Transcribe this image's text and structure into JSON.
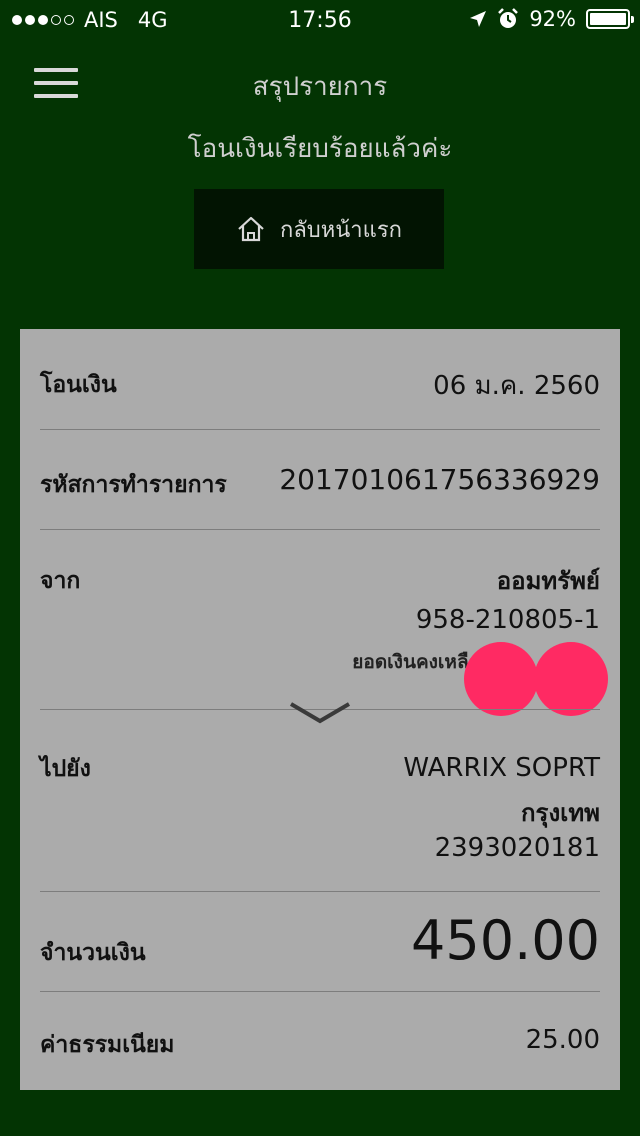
{
  "status_bar": {
    "carrier": "AIS",
    "network": "4G",
    "time": "17:56",
    "battery": "92%",
    "battery_level": 0.92,
    "signal_bars_filled": 3,
    "signal_bars_total": 5
  },
  "header": {
    "title": "สรุปรายการ",
    "subtitle": "โอนเงินเรียบร้อยแล้วค่ะ",
    "home_button_label": "กลับหน้าแรก"
  },
  "summary": {
    "transfer_label": "โอนเงิน",
    "transfer_date": "06 ม.ค. 2560",
    "ref_label": "รหัสการทำรายการ",
    "ref_value": "20170106175633692​9",
    "from_label": "จาก",
    "from_account_name": "ออมทรัพย์",
    "from_account_number": "958-210805-1",
    "from_balance_label": "ยอดเงินคงเหลือ",
    "to_label": "ไปยัง",
    "to_name": "WARRIX SOPRT",
    "to_bank": "กรุงเทพ",
    "to_account_number": "2393020181",
    "amount_label": "จำนวนเงิน",
    "amount_value": "450.00",
    "fee_label": "ค่าธรรมเนียม",
    "fee_value": "25.00"
  },
  "colors": {
    "background": "#033403",
    "card": "#ababab",
    "home_button": "#021402",
    "redaction": "#ff2a63"
  },
  "icons": [
    "menu-icon",
    "home-icon",
    "chevron-down-icon",
    "location-arrow-icon",
    "alarm-icon",
    "battery-icon"
  ]
}
